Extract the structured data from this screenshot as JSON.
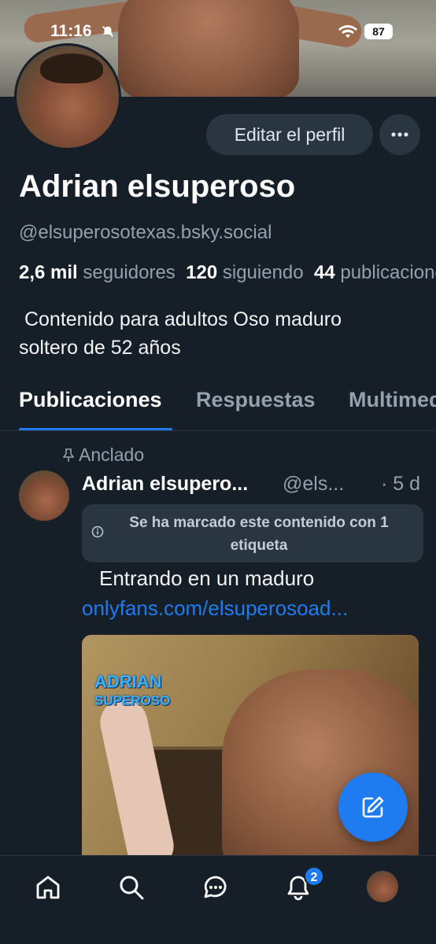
{
  "status_bar": {
    "time": "11:16",
    "battery": "87"
  },
  "profile": {
    "edit_label": "Editar el perfil",
    "display_name": "Adrian elsuperoso",
    "handle": "@elsuperosotexas.bsky.social",
    "followers_count": "2,6 mil",
    "followers_label": "seguidores",
    "following_count": "120",
    "following_label": "siguiendo",
    "posts_count": "44",
    "posts_label": "publicaciones",
    "bio_line1": "Contenido para adultos Oso maduro",
    "bio_line2": "soltero de 52 años"
  },
  "tabs": [
    {
      "label": "Publicaciones",
      "active": true
    },
    {
      "label": "Respuestas",
      "active": false
    },
    {
      "label": "Multimedia",
      "active": false
    }
  ],
  "post": {
    "pinned_label": "Anclado",
    "author_name": "Adrian elsupero...",
    "author_handle": "@els...",
    "time": "· 5 d",
    "label_notice": "Se ha marcado este contenido con 1 etiqueta",
    "text": "Entrando en un maduro",
    "link": "onlyfans.com/elsuperosoad...",
    "media_logo_line1": "ADRIAN",
    "media_logo_line2": "SUPEROSO"
  },
  "nav": {
    "items": [
      "home-icon",
      "search-icon",
      "chat-icon",
      "notifications-icon",
      "profile-avatar"
    ],
    "notifications_badge": "2"
  },
  "colors": {
    "background": "#161e27",
    "accent": "#1f7cf0",
    "muted": "#93a0ae",
    "surface": "#2a3542"
  }
}
